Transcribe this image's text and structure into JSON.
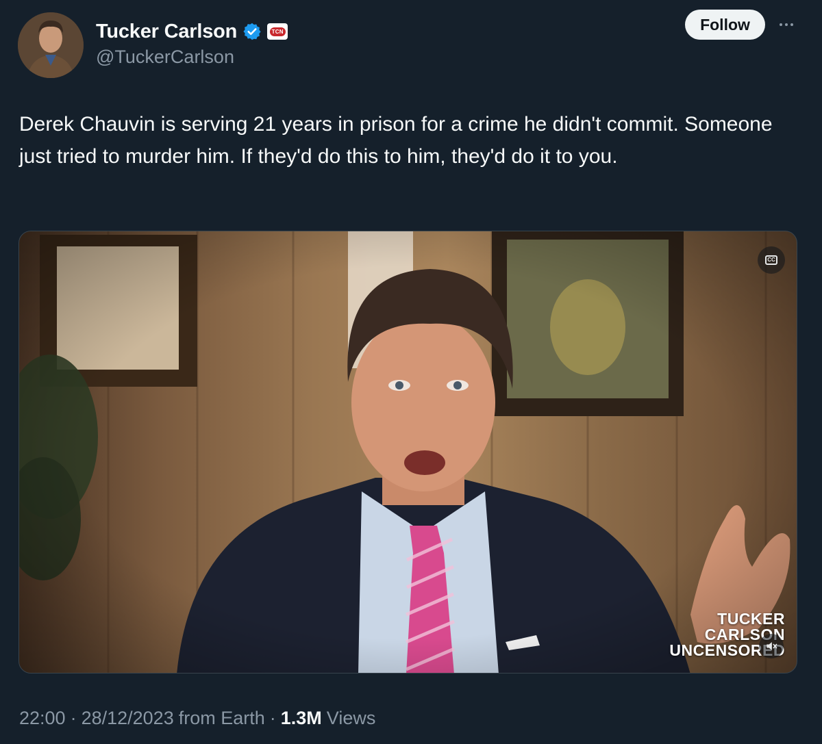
{
  "author": {
    "display_name": "Tucker Carlson",
    "handle": "@TuckerCarlson",
    "verified_icon": "verified-badge-icon",
    "affiliate_badge_text": "TCN"
  },
  "actions": {
    "follow_label": "Follow",
    "more_icon": "more-options-icon"
  },
  "tweet": {
    "text": "Derek Chauvin is serving 21 years in prison for a crime he didn't commit. Someone just tried to murder him. If they'd do this to him, they'd do it to you."
  },
  "media": {
    "type": "video",
    "watermark_lines": [
      "TUCKER",
      "CARLSON",
      "UNCENSORED"
    ],
    "captions_icon": "closed-captions-icon",
    "mute_icon": "muted-speaker-icon"
  },
  "meta": {
    "time": "22:00",
    "date": "28/12/2023",
    "source": "from Earth",
    "views_count": "1.3M",
    "views_label": "Views"
  },
  "colors": {
    "background": "#15202b",
    "text": "#f7f9f9",
    "secondary_text": "#8b98a5",
    "verified_blue": "#1d9bf0",
    "follow_button_bg": "#eff3f4"
  }
}
